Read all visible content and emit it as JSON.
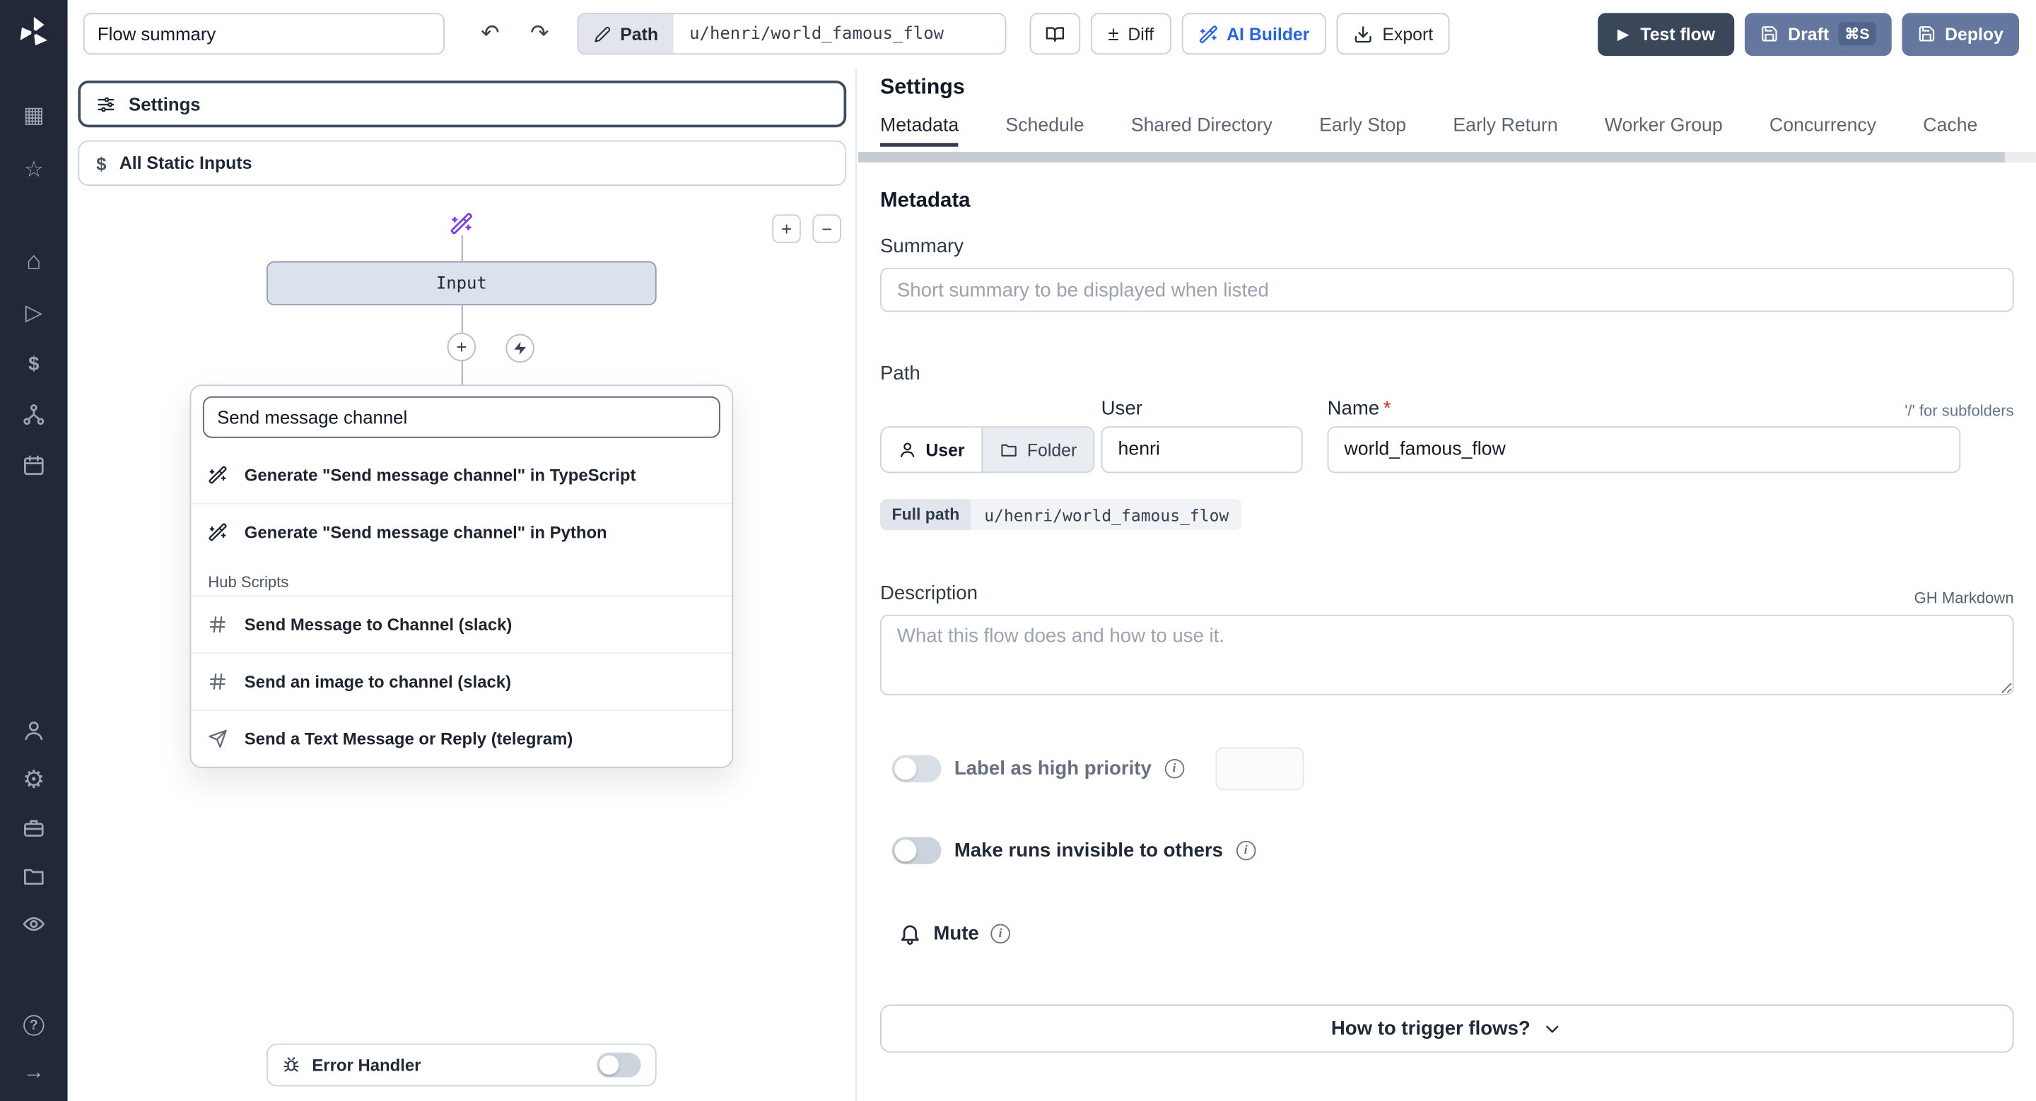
{
  "icons": {
    "undo": "↶",
    "redo": "↷",
    "diff": "±",
    "zoom_in": "+",
    "zoom_out": "−",
    "play": "▶",
    "grid": "▦",
    "star": "☆",
    "home": "⌂",
    "runs": "▷",
    "dollar": "$",
    "gear": "⚙",
    "arrow_right": "→",
    "help": "?",
    "info": "i",
    "plus": "+",
    "static_inputs": "$"
  },
  "topbar": {
    "flow_summary_value": "Flow summary",
    "path_label": "Path",
    "path_value": "u/henri/world_famous_flow",
    "diff_label": "Diff",
    "ai_builder_label": "AI Builder",
    "export_label": "Export",
    "test_flow_label": "Test flow",
    "draft_label": "Draft",
    "draft_shortcut": "⌘S",
    "deploy_label": "Deploy"
  },
  "flow_panel": {
    "settings_label": "Settings",
    "static_inputs_label": "All Static Inputs",
    "input_node_label": "Input",
    "search_value": "Send message channel",
    "gen_options": [
      "Generate \"Send message channel\" in TypeScript",
      "Generate \"Send message channel\" in Python"
    ],
    "hub_section_label": "Hub Scripts",
    "hub_options": [
      "Send Message to Channel (slack)",
      "Send an image to channel (slack)",
      "Send a Text Message or Reply (telegram)"
    ],
    "error_handler_label": "Error Handler"
  },
  "settings_panel": {
    "title": "Settings",
    "tabs": [
      "Metadata",
      "Schedule",
      "Shared Directory",
      "Early Stop",
      "Early Return",
      "Worker Group",
      "Concurrency",
      "Cache"
    ],
    "metadata": {
      "heading": "Metadata",
      "summary_label": "Summary",
      "summary_placeholder": "Short summary to be displayed when listed",
      "path_label": "Path",
      "owner_user_label": "User",
      "owner_folder_label": "Folder",
      "user_col_label": "User",
      "name_col_label": "Name",
      "required_mark": "*",
      "subfolder_hint": "'/' for subfolders",
      "user_value": "henri",
      "name_value": "world_famous_flow",
      "full_path_label": "Full path",
      "full_path_value": "u/henri/world_famous_flow",
      "description_label": "Description",
      "markdown_hint": "GH Markdown",
      "description_placeholder": "What this flow does and how to use it.",
      "priority_label": "Label as high priority",
      "invisible_label": "Make runs invisible to others",
      "mute_label": "Mute",
      "trigger_button_label": "How to trigger flows?"
    }
  }
}
